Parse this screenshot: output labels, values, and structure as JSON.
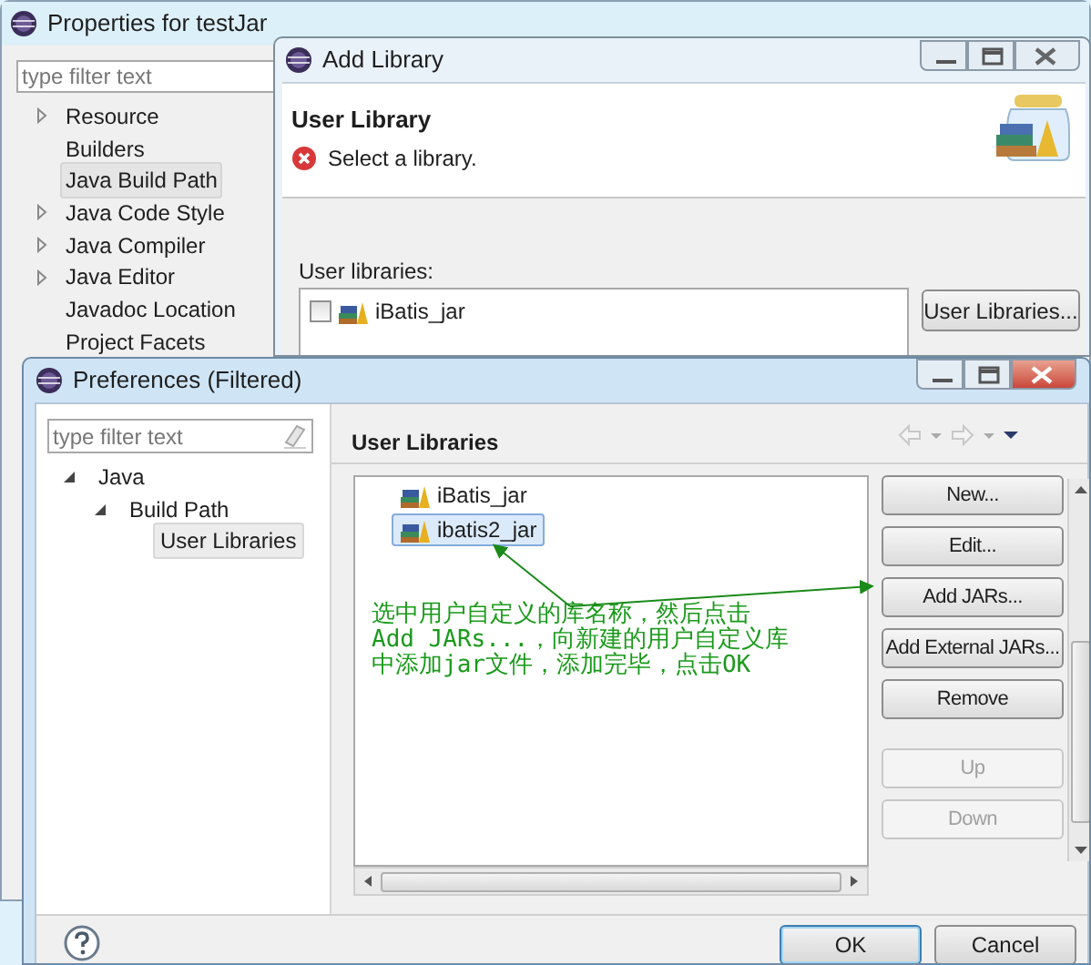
{
  "properties_window": {
    "title": "Properties for testJar",
    "filter": {
      "placeholder": "type filter text"
    },
    "tree": [
      {
        "label": "Resource",
        "expandable": true,
        "selected": false
      },
      {
        "label": "Builders",
        "expandable": false,
        "selected": false
      },
      {
        "label": "Java Build Path",
        "expandable": false,
        "selected": true
      },
      {
        "label": "Java Code Style",
        "expandable": true,
        "selected": false
      },
      {
        "label": "Java Compiler",
        "expandable": true,
        "selected": false
      },
      {
        "label": "Java Editor",
        "expandable": true,
        "selected": false
      },
      {
        "label": "Javadoc Location",
        "expandable": false,
        "selected": false
      },
      {
        "label": "Project Facets",
        "expandable": false,
        "selected": false
      }
    ]
  },
  "add_library_window": {
    "title": "Add Library",
    "header": {
      "title": "User Library",
      "message": "Select a library."
    },
    "list_label": "User libraries:",
    "libraries": [
      {
        "label": "iBatis_jar",
        "checked": false
      }
    ],
    "button": "User Libraries..."
  },
  "preferences_window": {
    "title": "Preferences (Filtered)",
    "filter": {
      "placeholder": "type filter text"
    },
    "tree": [
      {
        "label": "Java",
        "expanded": true,
        "selected": false,
        "children": [
          {
            "label": "Build Path",
            "expanded": true,
            "selected": false,
            "children": [
              {
                "label": "User Libraries",
                "selected": true
              }
            ]
          }
        ]
      }
    ],
    "page_title": "User Libraries",
    "libraries": [
      {
        "label": "iBatis_jar",
        "selected": false
      },
      {
        "label": "ibatis2_jar",
        "selected": true
      }
    ],
    "annotation": [
      "选中用户自定义的库名称，然后点击",
      "Add JARs...，向新建的用户自定义库",
      "中添加jar文件，添加完毕，点击OK"
    ],
    "buttons": [
      {
        "label": "New...",
        "disabled": false
      },
      {
        "label": "Edit...",
        "disabled": false
      },
      {
        "label": "Add JARs...",
        "disabled": false
      },
      {
        "label": "Add External JARs...",
        "disabled": false
      },
      {
        "label": "Remove",
        "disabled": false
      },
      {
        "label": "Up",
        "disabled": true
      },
      {
        "label": "Down",
        "disabled": true
      }
    ],
    "dialog_buttons": [
      {
        "label": "OK",
        "default": true
      },
      {
        "label": "Cancel",
        "default": false
      }
    ]
  }
}
